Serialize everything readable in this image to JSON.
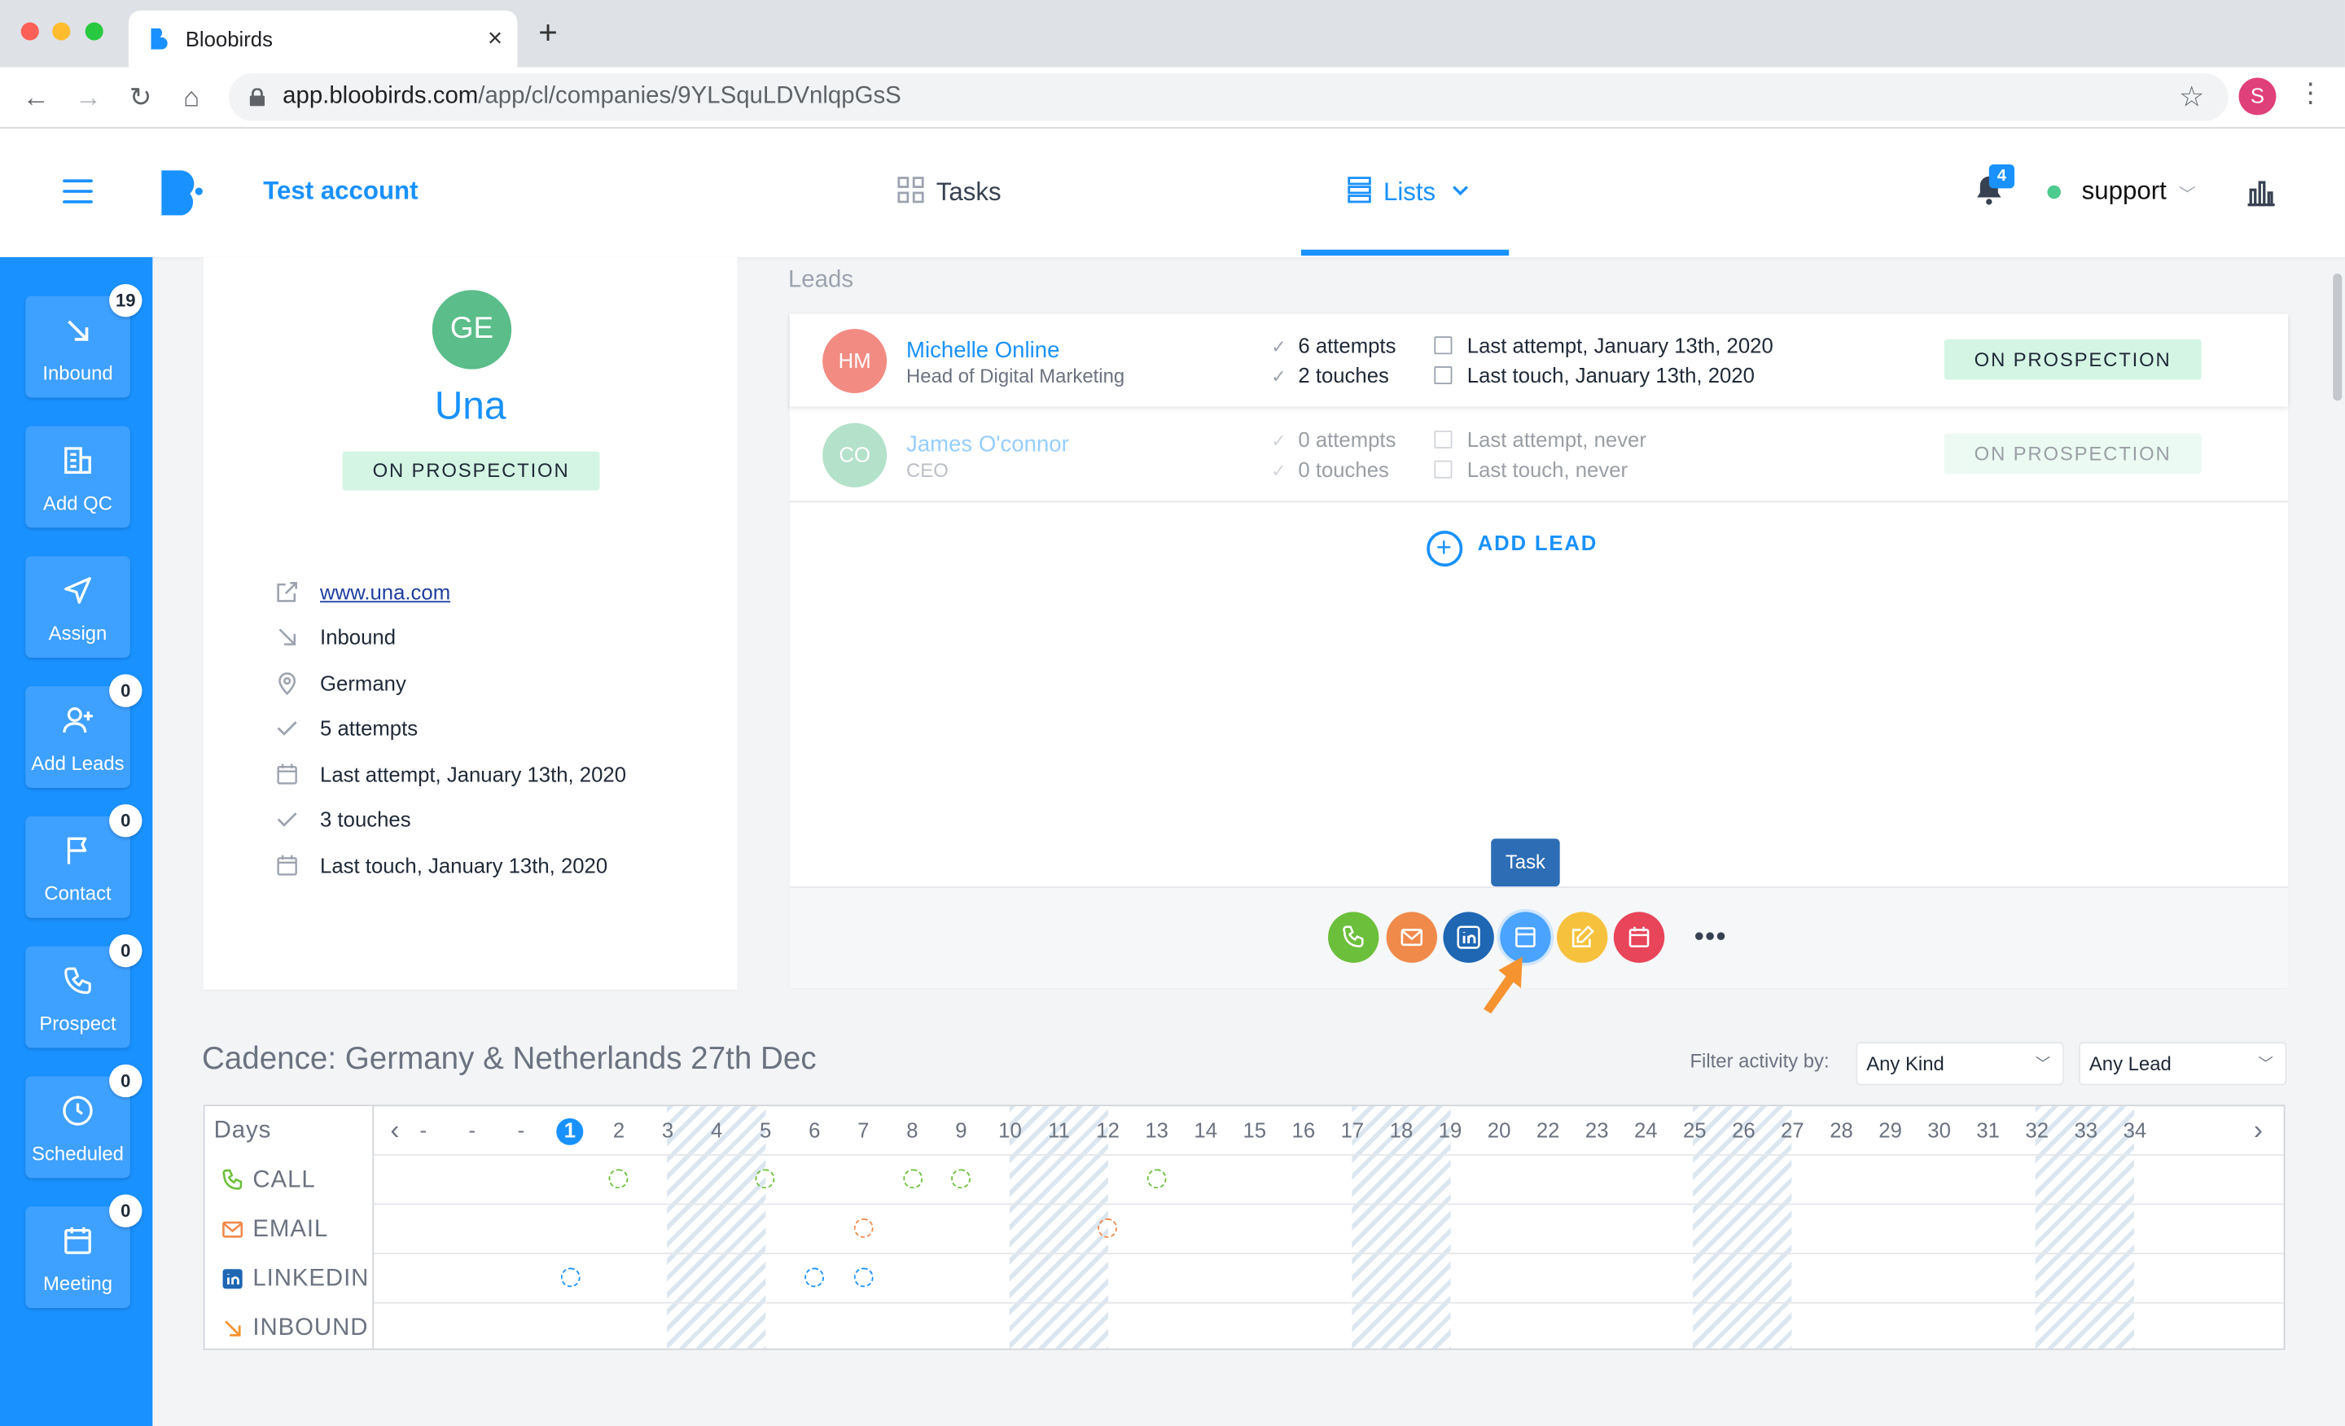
{
  "browser": {
    "tab_title": "Bloobirds",
    "url_host": "app.bloobirds.com",
    "url_path": "/app/cl/companies/9YLSquLDVnlqpGsS",
    "profile_initial": "S"
  },
  "header": {
    "account": "Test account",
    "nav_tasks": "Tasks",
    "nav_lists": "Lists",
    "notifications": "4",
    "user": "support"
  },
  "sidebar": {
    "items": [
      {
        "label": "Inbound",
        "badge": "19",
        "icon": "arrow-down-right-icon"
      },
      {
        "label": "Add QC",
        "badge": "",
        "icon": "building-icon"
      },
      {
        "label": "Assign",
        "badge": "",
        "icon": "send-icon"
      },
      {
        "label": "Add Leads",
        "badge": "0",
        "icon": "user-plus-icon"
      },
      {
        "label": "Contact",
        "badge": "0",
        "icon": "flag-icon"
      },
      {
        "label": "Prospect",
        "badge": "0",
        "icon": "phone-icon"
      },
      {
        "label": "Scheduled",
        "badge": "0",
        "icon": "clock-icon"
      },
      {
        "label": "Meeting",
        "badge": "0",
        "icon": "calendar-icon"
      }
    ]
  },
  "company": {
    "initials": "GE",
    "name": "Una",
    "status": "ON PROSPECTION",
    "website": "www.una.com",
    "source": "Inbound",
    "country": "Germany",
    "attempts": "5 attempts",
    "last_attempt": "Last attempt, January 13th, 2020",
    "touches": "3 touches",
    "last_touch": "Last touch, January 13th, 2020"
  },
  "leads": {
    "title": "Leads",
    "rows": [
      {
        "initials": "HM",
        "name": "Michelle Online",
        "role": "Head of Digital Marketing",
        "attempts": "6 attempts",
        "touches": "2 touches",
        "last_attempt": "Last attempt, January 13th, 2020",
        "last_touch": "Last touch, January 13th, 2020",
        "status": "ON PROSPECTION",
        "color": "#f28b82"
      },
      {
        "initials": "CO",
        "name": "James O'connor",
        "role": "CEO",
        "attempts": "0 attempts",
        "touches": "0 touches",
        "last_attempt": "Last attempt, never",
        "last_touch": "Last touch, never",
        "status": "ON PROSPECTION",
        "color": "#5bbd89"
      }
    ],
    "add_lead": "ADD LEAD",
    "tooltip": "Task",
    "more": "•••",
    "actions": [
      {
        "name": "call",
        "color": "#6cbf3b"
      },
      {
        "name": "email",
        "color": "#f08a4b"
      },
      {
        "name": "linkedin",
        "color": "#1f66b3"
      },
      {
        "name": "task",
        "color": "#4aa3ff"
      },
      {
        "name": "note",
        "color": "#f6c23e"
      },
      {
        "name": "meeting",
        "color": "#e8445a"
      }
    ]
  },
  "cadence": {
    "title": "Cadence: Germany & Netherlands 27th Dec",
    "filter_label": "Filter activity by:",
    "filter_kind": "Any Kind",
    "filter_lead": "Any Lead",
    "days_label": "Days",
    "days": [
      "-",
      "-",
      "-",
      "1",
      "2",
      "3",
      "4",
      "5",
      "6",
      "7",
      "8",
      "9",
      "10",
      "11",
      "12",
      "13",
      "14",
      "15",
      "16",
      "17",
      "18",
      "19",
      "20",
      "22",
      "23",
      "24",
      "25",
      "26",
      "27",
      "28",
      "29",
      "30",
      "31",
      "32",
      "33",
      "34"
    ],
    "rows": [
      "CALL",
      "EMAIL",
      "LINKEDIN",
      "INBOUND"
    ],
    "marks": {
      "CALL": [
        "2",
        "5",
        "8",
        "9",
        "13"
      ],
      "EMAIL": [
        "7",
        "12"
      ],
      "LINKEDIN": [
        "1",
        "6",
        "7"
      ]
    }
  }
}
